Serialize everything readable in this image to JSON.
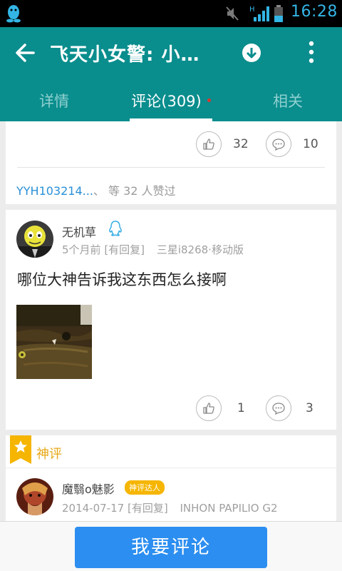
{
  "status_bar": {
    "time": "16:28",
    "network": "H"
  },
  "app_bar": {
    "title": "飞天小女警: 小…",
    "tabs": [
      {
        "label": "详情"
      },
      {
        "label": "评论(309)"
      },
      {
        "label": "相关"
      }
    ]
  },
  "post_top": {
    "like_count": "32",
    "comment_count": "10",
    "likers_name": "YYH103214...",
    "likers_suffix": "、 等 32 人赞过"
  },
  "comment": {
    "username": "无机草",
    "time": "5个月前",
    "reply_status": "[有回复]",
    "device": "三星i8268·移动版",
    "text": "哪位大神告诉我这东西怎么接啊",
    "like_count": "1",
    "comment_count": "3"
  },
  "shenping": {
    "label": "神评",
    "username": "魔翳o魅影",
    "tag": "神评达人",
    "date": "2014-07-17",
    "reply_status": "[有回复]",
    "device": "INHON PAPILIO G2"
  },
  "bottom": {
    "comment_button": "我要评论"
  },
  "colors": {
    "app_bar": "#0a8d8d",
    "accent_blue": "#2c8ef0",
    "shenping_gold": "#f5b500",
    "link_blue": "#2a8fd6"
  },
  "icons": [
    "qq-icon",
    "mute-icon",
    "signal-icon",
    "battery-icon",
    "back-arrow-icon",
    "download-icon",
    "more-vert-icon",
    "thumb-up-icon",
    "comment-bubble-icon",
    "qq-penguin-icon",
    "star-badge-icon"
  ]
}
